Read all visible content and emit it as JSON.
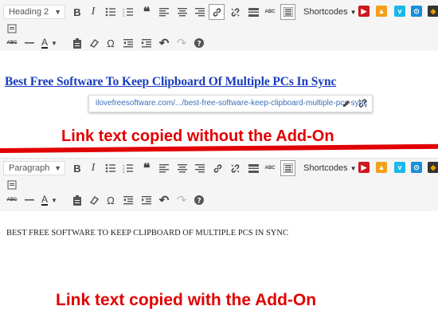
{
  "top_editor": {
    "format_select": "Heading 2",
    "shortcodes_label": "Shortcodes",
    "headline": "Best Free Software To Keep Clipboard Of Multiple PCs In Sync",
    "link_url": "ilovefreesoftware.com/.../best-free-software-keep-clipboard-multiple-pcs-sync",
    "caption": "Link text copied without the Add-On"
  },
  "bottom_editor": {
    "format_select": "Paragraph",
    "shortcodes_label": "Shortcodes",
    "plain_text": "BEST FREE SOFTWARE TO KEEP CLIPBOARD OF MULTIPLE PCS IN SYNC",
    "caption": "Link text copied with the Add-On"
  },
  "labels": {
    "abc": "ABC"
  },
  "colors": {
    "accent_red": "#e10000",
    "link_blue": "#1a3dbd",
    "toolbar_bg": "#f5f5f5"
  }
}
